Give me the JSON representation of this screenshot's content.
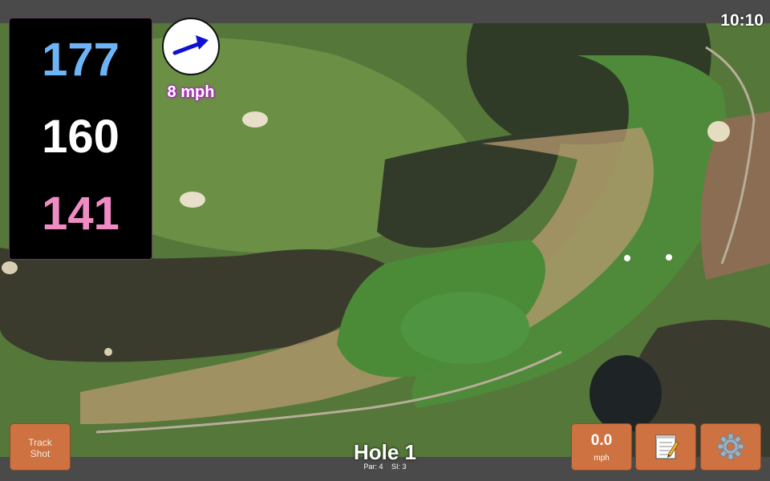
{
  "status_bar": {
    "time": "10:10"
  },
  "distances": {
    "back": "177",
    "center": "160",
    "front": "141"
  },
  "wind": {
    "speed_label": "8 mph",
    "icon": "wind-direction-arrow-icon"
  },
  "buttons": {
    "track_shot_line1": "Track",
    "track_shot_line2": "Shot",
    "speed_value": "0.0",
    "speed_unit": "mph",
    "notes_icon": "notepad-icon",
    "settings_icon": "gear-icon"
  },
  "hole": {
    "title": "Hole 1",
    "par": "Par: 4",
    "si": "SI: 3"
  },
  "colors": {
    "back_distance": "#6cb4f5",
    "center_distance": "#ffffff",
    "front_distance": "#f08cc4",
    "button_orange": "#cd7240",
    "wind_text_glow": "#b21bd0"
  }
}
